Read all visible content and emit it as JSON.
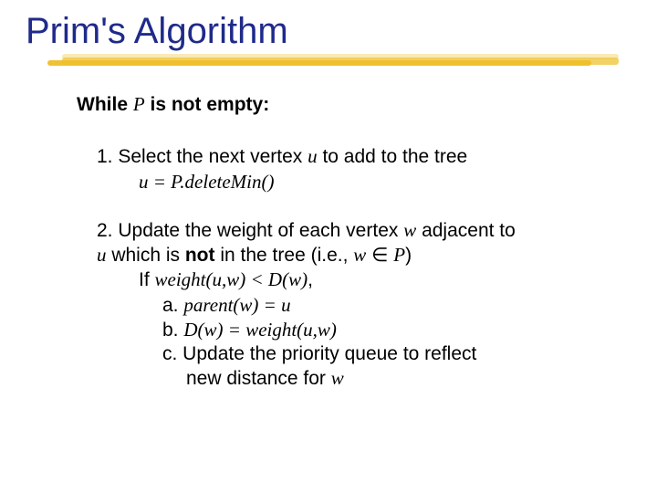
{
  "title": "Prim's Algorithm",
  "while": {
    "prefix": "While ",
    "P": "P",
    "suffix": " is not empty:"
  },
  "step1": {
    "line": "1. Select the next vertex ",
    "u": "u",
    "rest": " to add to the tree",
    "assign_u": "u = P.deleteMin()"
  },
  "step2": {
    "lead": "2. Update the weight of each vertex ",
    "w": "w",
    "adj": " adjacent to",
    "cont_u": "u",
    "cont_mid": " which is ",
    "not": "not",
    "cont_tail": " in the tree (i.e., ",
    "w2": "w",
    "in": " ∈ ",
    "P": "P",
    "close": ")",
    "if_lead": "If ",
    "if_cond": "weight(u,w) < D(w)",
    "if_comma": ",",
    "a_lead": "a. ",
    "a_body": "parent(w) = u",
    "b_lead": "b. ",
    "b_body": "D(w) = weight(u,w)",
    "c_lead": "c. Update the priority queue to reflect",
    "c_cont_lead": "new distance for ",
    "c_w": "w"
  }
}
